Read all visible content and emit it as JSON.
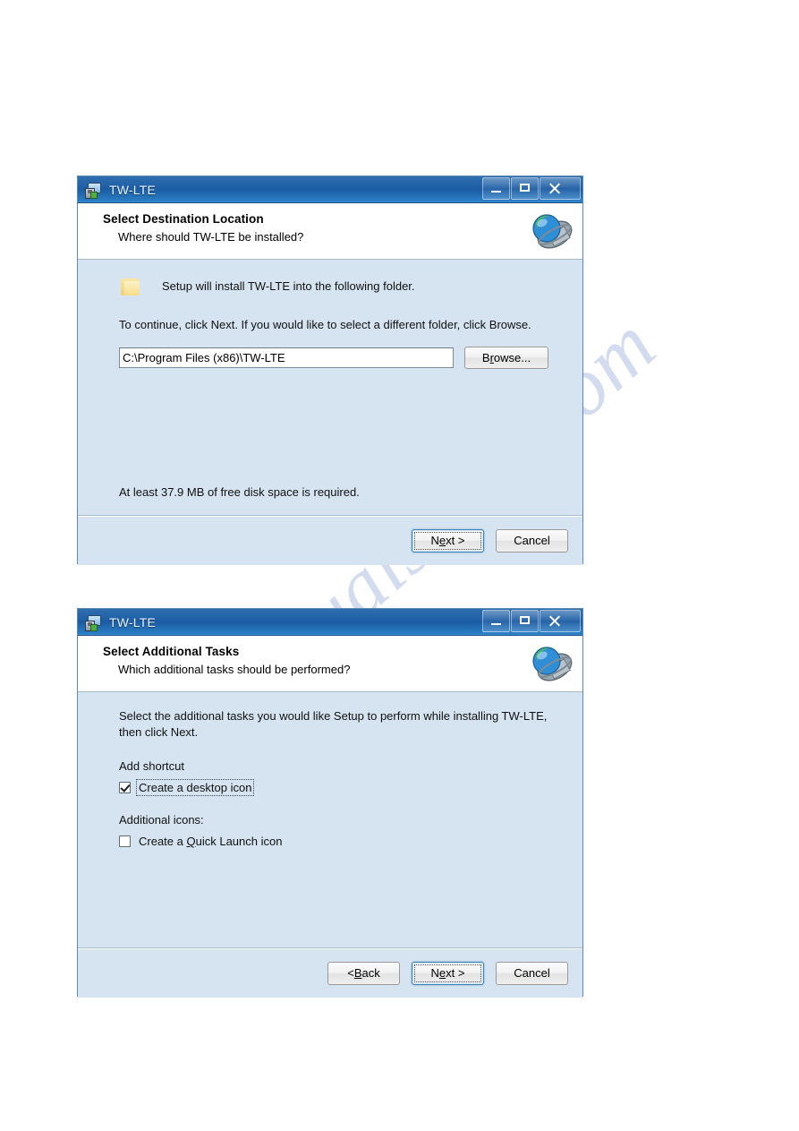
{
  "watermark": {
    "text": "manualshive.com"
  },
  "dialogs": [
    {
      "id": "destination",
      "titlebar": {
        "title": "TW-LTE",
        "icon": "installer-icon",
        "minimize_label": "Minimize",
        "maximize_label": "Maximize",
        "close_label": "Close"
      },
      "header": {
        "title": "Select Destination Location",
        "subtitle": "Where should TW-LTE be installed?",
        "icon": "globe-wizard-icon"
      },
      "body": {
        "folder_icon": "folder-icon",
        "line1": "Setup will install TW-LTE into the following folder.",
        "line2": "To continue, click Next. If you would like to select a different folder, click Browse.",
        "path_value": "C:\\Program Files (x86)\\TW-LTE",
        "path_placeholder": "C:\\Program Files (x86)\\TW-LTE",
        "browse_label_pre": "B",
        "browse_label_accel": "r",
        "browse_label_post": "owse...",
        "disk_note": "At least 37.9 MB of free disk space is required."
      },
      "footer": {
        "next_pre": "N",
        "next_accel": "e",
        "next_post": "xt >",
        "cancel_label": "Cancel"
      }
    },
    {
      "id": "tasks",
      "titlebar": {
        "title": "TW-LTE",
        "icon": "installer-icon",
        "minimize_label": "Minimize",
        "maximize_label": "Maximize",
        "close_label": "Close"
      },
      "header": {
        "title": "Select Additional Tasks",
        "subtitle": "Which additional tasks should be performed?",
        "icon": "globe-wizard-icon"
      },
      "body": {
        "intro_line1": "Select the additional tasks you would like Setup to perform while installing TW-LTE,",
        "intro_line2": "then click Next.",
        "group1_label": "Add shortcut",
        "group2_label": "Additional icons:",
        "checkbox1": {
          "label": "Create a desktop icon",
          "checked": true,
          "focused": true
        },
        "checkbox2": {
          "label_pre": "Create a ",
          "label_accel": "Q",
          "label_post": "uick Launch icon",
          "checked": false,
          "focused": false
        }
      },
      "footer": {
        "back_pre": "< ",
        "back_accel": "B",
        "back_post": "ack",
        "next_pre": "N",
        "next_accel": "e",
        "next_post": "xt >",
        "cancel_label": "Cancel"
      }
    }
  ]
}
